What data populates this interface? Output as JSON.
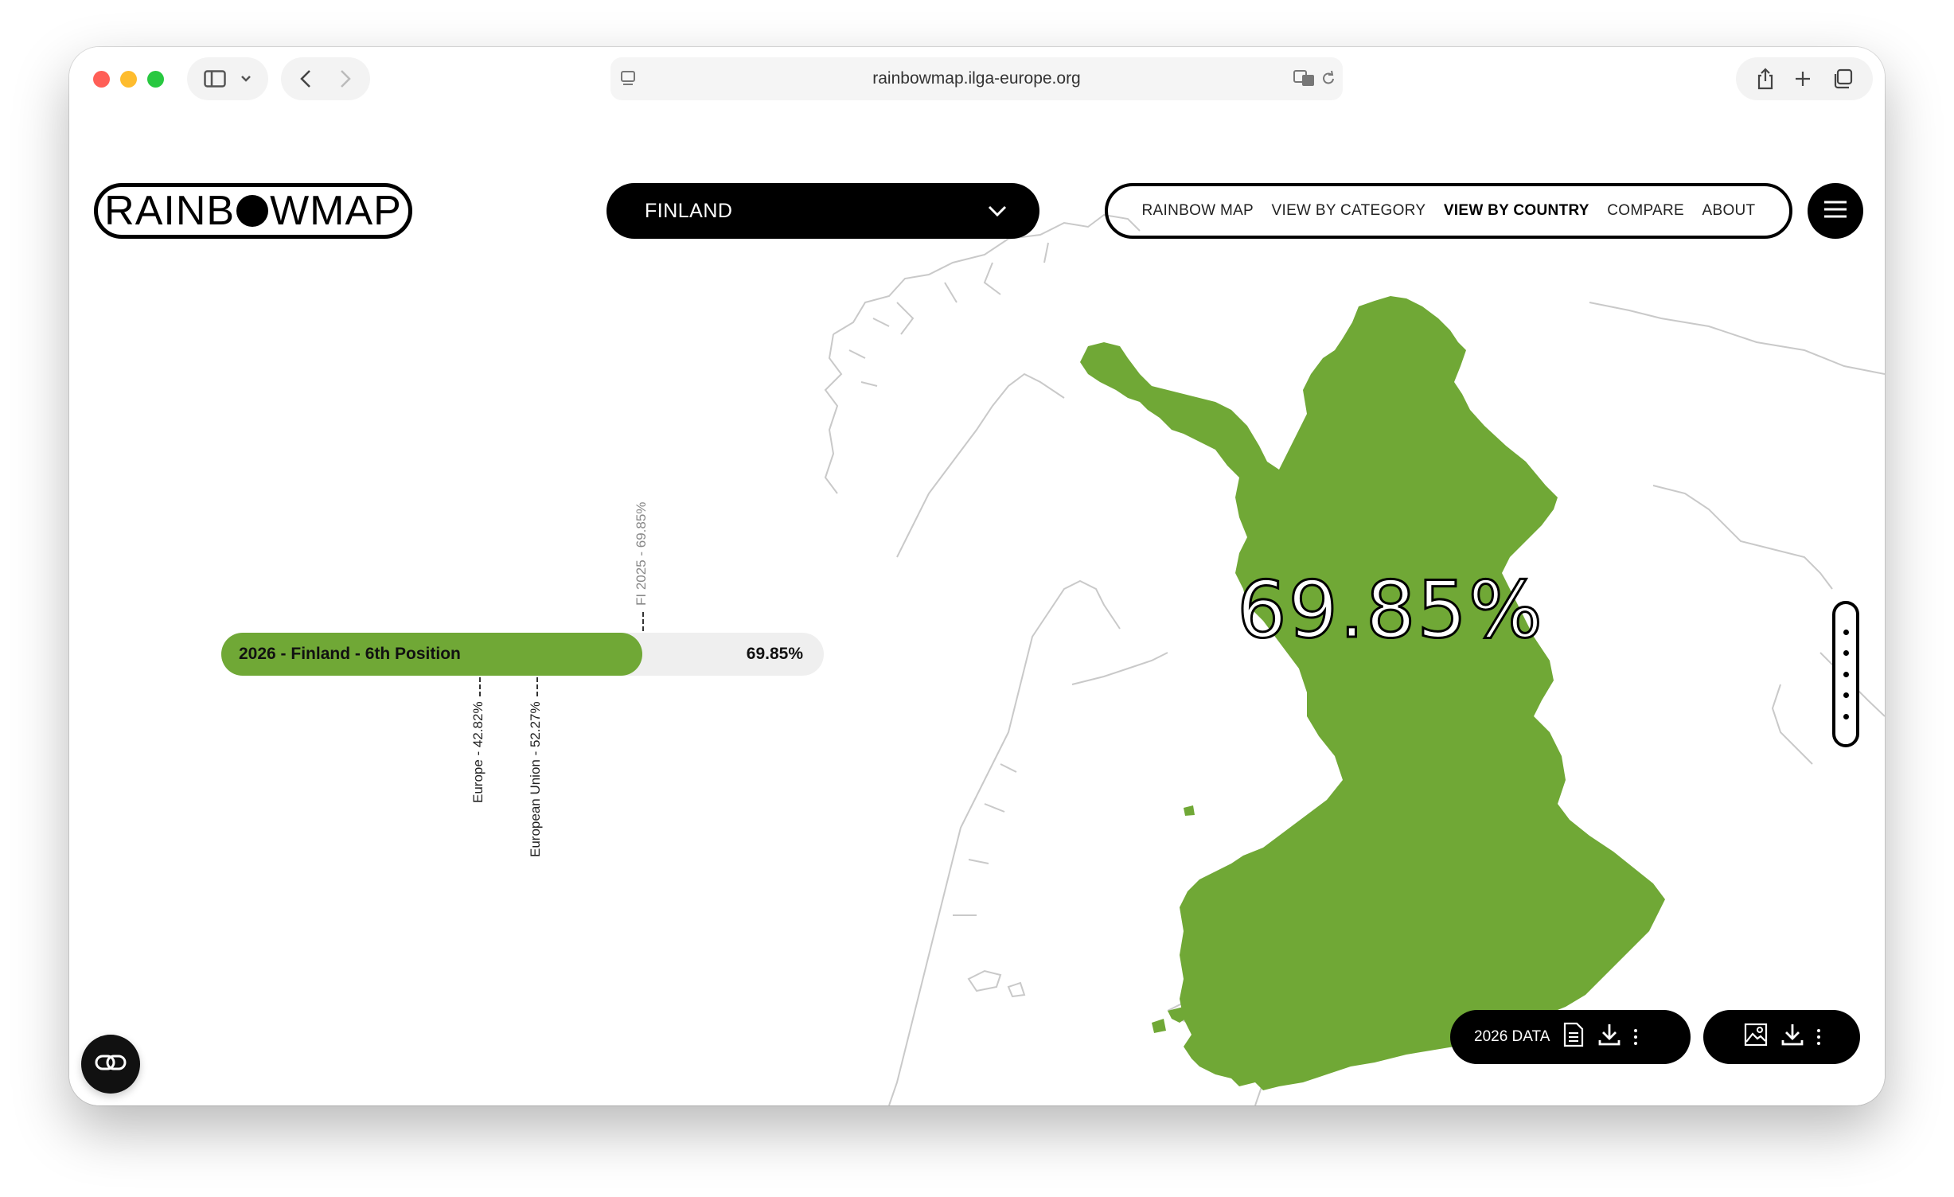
{
  "browser": {
    "url": "rainbowmap.ilga-europe.org"
  },
  "logo": {
    "text_before": "RAINB",
    "text_after": "WMAP"
  },
  "country_select": {
    "value": "FINLAND"
  },
  "nav": {
    "items": [
      {
        "label": "RAINBOW MAP",
        "active": false
      },
      {
        "label": "VIEW BY CATEGORY",
        "active": false
      },
      {
        "label": "VIEW BY COUNTRY",
        "active": true
      },
      {
        "label": "COMPARE",
        "active": false
      },
      {
        "label": "ABOUT",
        "active": false
      }
    ]
  },
  "map": {
    "country": "Finland",
    "score_label": "69.85%",
    "fill_color": "#70a836"
  },
  "chart_data": {
    "type": "bar",
    "bar_label": "2026 - Finland - 6th Position",
    "value_label": "69.85%",
    "value": 69.85,
    "range": [
      0,
      100
    ],
    "color": "#70a836",
    "markers": [
      {
        "label": "FI 2025 - 69.85%",
        "value": 69.85,
        "side": "top"
      },
      {
        "label": "Europe - 42.82%",
        "value": 42.82,
        "side": "bottom"
      },
      {
        "label": "European Union - 52.27%",
        "value": 52.27,
        "side": "bottom"
      }
    ]
  },
  "downloads": {
    "data_label": "2026 DATA"
  }
}
